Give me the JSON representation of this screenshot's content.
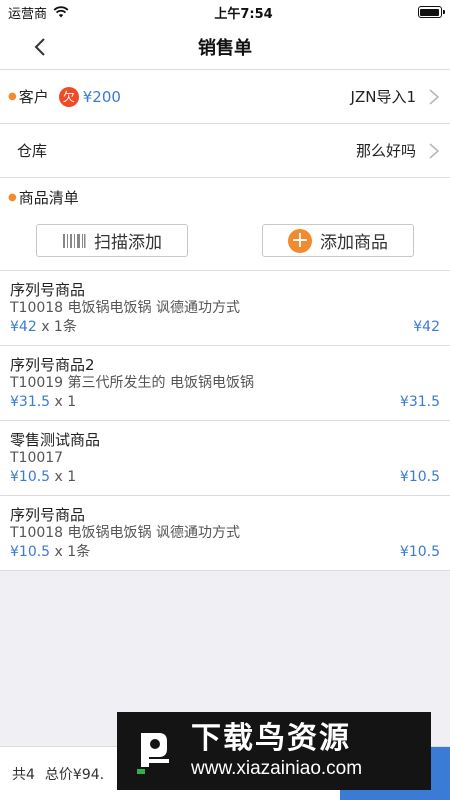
{
  "status_bar": {
    "carrier": "运营商",
    "time": "上午7:54"
  },
  "nav": {
    "title": "销售单"
  },
  "customer": {
    "label": "客户",
    "debt_badge": "欠",
    "debt_amount": "¥200",
    "value": "JZN导入1"
  },
  "warehouse": {
    "label": "仓库",
    "value": "那么好吗"
  },
  "goods": {
    "header": "商品清单",
    "scan_button": "扫描添加",
    "add_button": "添加商品",
    "items": [
      {
        "name": "序列号商品",
        "desc": "T10018 电饭锅电饭锅 讽德通功方式",
        "price": "¥42",
        "qty": "x 1条",
        "total": "¥42"
      },
      {
        "name": "序列号商品2",
        "desc": "T10019 第三代所发生的 电饭锅电饭锅",
        "price": "¥31.5",
        "qty": "x 1",
        "total": "¥31.5"
      },
      {
        "name": "零售测试商品",
        "desc": "T10017",
        "price": "¥10.5",
        "qty": "x 1",
        "total": "¥10.5"
      },
      {
        "name": "序列号商品",
        "desc": "T10018 电饭锅电饭锅 讽德通功方式",
        "price": "¥10.5",
        "qty": "x 1条",
        "total": "¥10.5"
      }
    ]
  },
  "footer": {
    "count": "共4",
    "total": "总价¥94."
  },
  "watermark": {
    "title": "下载鸟资源",
    "url": "www.xiazainiao.com"
  },
  "colors": {
    "accent_blue": "#3a7bd5",
    "accent_orange": "#f28a30",
    "debt_red": "#f04a25"
  }
}
